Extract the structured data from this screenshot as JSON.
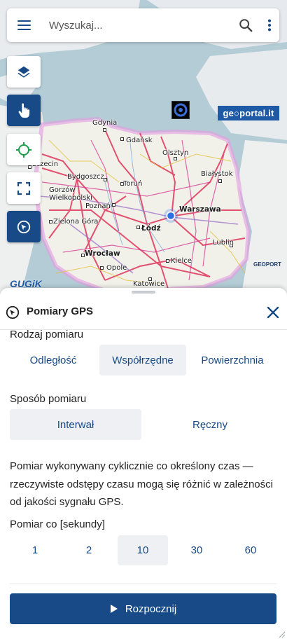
{
  "search": {
    "placeholder": "Wyszukaj..."
  },
  "map": {
    "logo_text": "ge○portal.it",
    "provider_logo": "GUGiK",
    "watermark": "GEOPORT",
    "cities": [
      {
        "name": "Gdynia",
        "big": false
      },
      {
        "name": "Gdańsk",
        "big": false
      },
      {
        "name": "Olsztyn",
        "big": false
      },
      {
        "name": "Szczecin",
        "big": false
      },
      {
        "name": "Bydgoszcz",
        "big": false
      },
      {
        "name": "Toruń",
        "big": false
      },
      {
        "name": "Białystok",
        "big": false
      },
      {
        "name": "Gorzów Wielkopolski",
        "big": false
      },
      {
        "name": "Poznań",
        "big": false
      },
      {
        "name": "Warszawa",
        "big": true
      },
      {
        "name": "Zielona Góra",
        "big": false
      },
      {
        "name": "Łódź",
        "big": true
      },
      {
        "name": "Lublin",
        "big": false
      },
      {
        "name": "Wrocław",
        "big": true
      },
      {
        "name": "Opole",
        "big": false
      },
      {
        "name": "Kielce",
        "big": false
      },
      {
        "name": "Katowice",
        "big": false
      }
    ],
    "tools": [
      {
        "icon": "layers-icon",
        "active": false
      },
      {
        "icon": "touch-hand-icon",
        "active": true
      },
      {
        "icon": "locate-crosshair-icon",
        "active": false
      },
      {
        "icon": "fullscreen-icon",
        "active": false
      },
      {
        "icon": "gps-measure-icon",
        "active": true
      }
    ]
  },
  "panel": {
    "title": "Pomiary GPS",
    "type_label": "Rodzaj pomiaru",
    "type_options": [
      "Odległość",
      "Współrzędne",
      "Powierzchnia"
    ],
    "type_selected": "Współrzędne",
    "method_label": "Sposób pomiaru",
    "method_options": [
      "Interwał",
      "Ręczny"
    ],
    "method_selected": "Interwał",
    "description": "Pomiar wykonywany cyklicznie co określony czas — rzeczywiste odstępy czasu mogą się różnić w zależności od jakości sygnału GPS.",
    "interval_label": "Pomiar co [sekundy]",
    "interval_options": [
      "1",
      "2",
      "10",
      "30",
      "60"
    ],
    "interval_selected": "10",
    "start_label": "Rozpocznij"
  },
  "colors": {
    "accent": "#174a86",
    "selected_bg": "#eef0f3",
    "location_dot": "#2f6fe6"
  }
}
